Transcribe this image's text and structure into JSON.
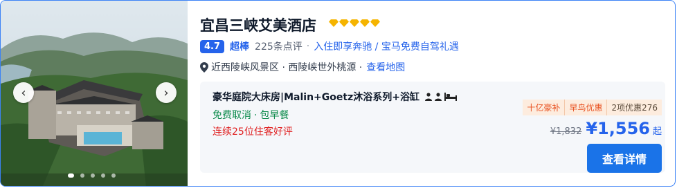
{
  "hotel": {
    "name": "宜昌三峡艾美酒店",
    "star_icon": "diamond-icon",
    "star_count": 5,
    "score": "4.7",
    "score_text": "超棒",
    "review_count": "225条点评",
    "promo": "入住即享奔驰 / 宝马免费自驾礼遇",
    "location": "近西陵峡风景区 · 西陵峡世外桃源 ·",
    "map_link": "查看地图"
  },
  "gallery": {
    "prev_icon": "chevron-left-icon",
    "next_icon": "chevron-right-icon",
    "dot_count": 5,
    "active_dot": 0
  },
  "room": {
    "name": "豪华庭院大床房|Malin+Goetz沐浴系列+浴缸",
    "free_cancel": "免费取消",
    "breakfast": "包早餐",
    "highlight": "连续25位住客好评"
  },
  "deal": {
    "tags": [
      "十亿豪补",
      "早鸟优惠",
      "2项优惠276"
    ],
    "old_price": "¥1,832",
    "price": "¥1,556",
    "price_suffix": "起",
    "button": "查看详情"
  },
  "colors": {
    "accent": "#2563eb",
    "button": "#1a73e8",
    "green": "#0a8a4a",
    "red": "#e02020",
    "orange": "#e8501f"
  }
}
